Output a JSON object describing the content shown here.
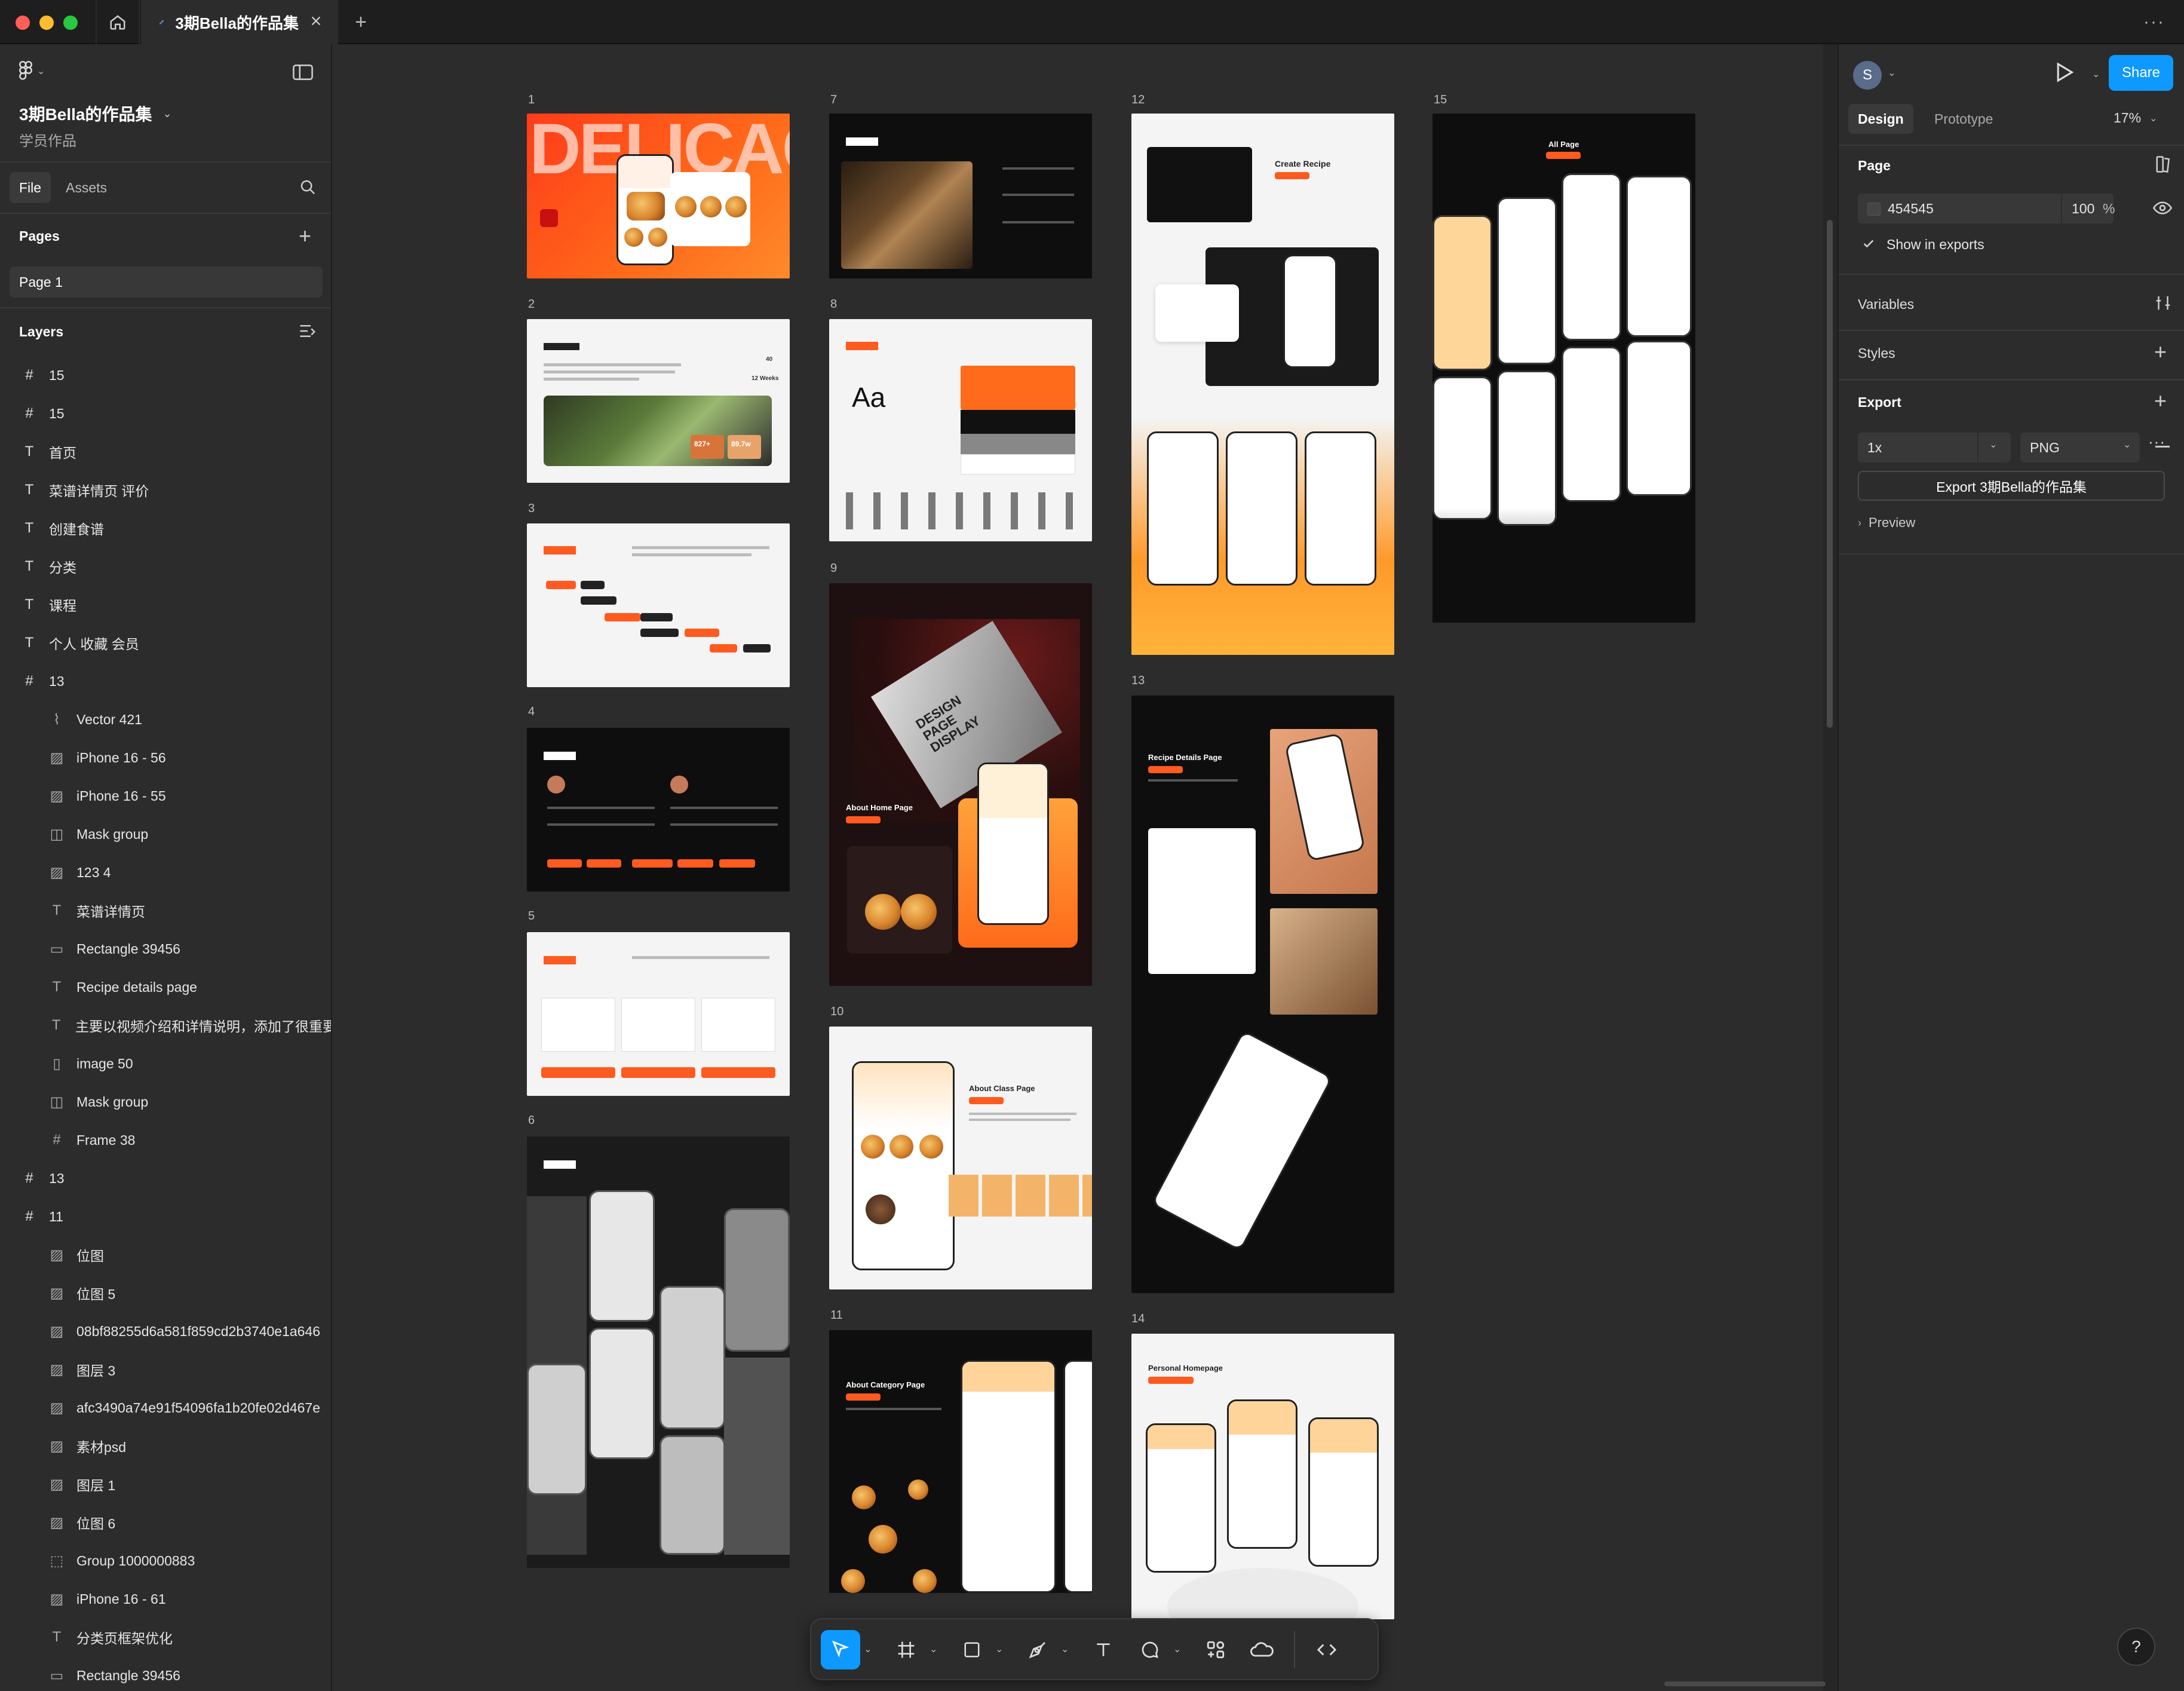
{
  "titlebar": {
    "doc_tab_label": "3期Bella的作品集",
    "new_tab": "+",
    "more": "···"
  },
  "file": {
    "name": "3期Bella的作品集",
    "subtitle": "学员作品",
    "tabs": [
      "File",
      "Assets"
    ]
  },
  "pages": {
    "title": "Pages",
    "items": [
      "Page 1"
    ]
  },
  "layers": {
    "title": "Layers",
    "items": [
      {
        "icon": "frame-icon",
        "glyph": "#",
        "label": "15",
        "level": 0
      },
      {
        "icon": "frame-icon",
        "glyph": "#",
        "label": "15",
        "level": 0
      },
      {
        "icon": "text-icon",
        "glyph": "T",
        "label": "首页",
        "level": 0
      },
      {
        "icon": "text-icon",
        "glyph": "T",
        "label": "菜谱详情页 评价",
        "level": 0
      },
      {
        "icon": "text-icon",
        "glyph": "T",
        "label": "创建食谱",
        "level": 0
      },
      {
        "icon": "text-icon",
        "glyph": "T",
        "label": "分类",
        "level": 0
      },
      {
        "icon": "text-icon",
        "glyph": "T",
        "label": "课程",
        "level": 0
      },
      {
        "icon": "text-icon",
        "glyph": "T",
        "label": "个人 收藏 会员",
        "level": 0
      },
      {
        "icon": "frame-icon",
        "glyph": "#",
        "label": "13",
        "level": 0
      },
      {
        "icon": "vector-icon",
        "glyph": "⌇",
        "label": "Vector 421",
        "level": 1
      },
      {
        "icon": "image-icon",
        "glyph": "▨",
        "label": "iPhone 16 - 56",
        "level": 1
      },
      {
        "icon": "image-icon",
        "glyph": "▨",
        "label": "iPhone 16 - 55",
        "level": 1
      },
      {
        "icon": "mask-icon",
        "glyph": "◫",
        "label": "Mask group",
        "level": 1
      },
      {
        "icon": "image-icon",
        "glyph": "▨",
        "label": "123 4",
        "level": 1
      },
      {
        "icon": "text-icon",
        "glyph": "T",
        "label": "菜谱详情页",
        "level": 1
      },
      {
        "icon": "rectangle-icon",
        "glyph": "▭",
        "label": "Rectangle 39456",
        "level": 1
      },
      {
        "icon": "text-icon",
        "glyph": "T",
        "label": "Recipe details page",
        "level": 1
      },
      {
        "icon": "text-icon",
        "glyph": "T",
        "label": "主要以视频介绍和详情说明，添加了很重要的",
        "level": 1
      },
      {
        "icon": "image-icon",
        "glyph": "▯",
        "label": "image 50",
        "level": 1
      },
      {
        "icon": "mask-icon",
        "glyph": "◫",
        "label": "Mask group",
        "level": 1
      },
      {
        "icon": "frame-icon",
        "glyph": "#",
        "label": "Frame 38",
        "level": 1
      },
      {
        "icon": "frame-icon",
        "glyph": "#",
        "label": "13",
        "level": 0
      },
      {
        "icon": "frame-icon",
        "glyph": "#",
        "label": "11",
        "level": 0
      },
      {
        "icon": "image-icon",
        "glyph": "▨",
        "label": "位图",
        "level": 1
      },
      {
        "icon": "image-icon",
        "glyph": "▨",
        "label": "位图 5",
        "level": 1
      },
      {
        "icon": "image-icon",
        "glyph": "▨",
        "label": "08bf88255d6a581f859cd2b3740e1a646",
        "level": 1
      },
      {
        "icon": "image-icon",
        "glyph": "▨",
        "label": "图层 3",
        "level": 1
      },
      {
        "icon": "image-icon",
        "glyph": "▨",
        "label": "afc3490a74e91f54096fa1b20fe02d467e",
        "level": 1
      },
      {
        "icon": "image-icon",
        "glyph": "▨",
        "label": "素材psd",
        "level": 1
      },
      {
        "icon": "image-icon",
        "glyph": "▨",
        "label": "图层 1",
        "level": 1
      },
      {
        "icon": "image-icon",
        "glyph": "▨",
        "label": "位图 6",
        "level": 1
      },
      {
        "icon": "group-icon",
        "glyph": "⬚",
        "label": "Group 1000000883",
        "level": 1
      },
      {
        "icon": "image-icon",
        "glyph": "▨",
        "label": "iPhone 16 - 61",
        "level": 1
      },
      {
        "icon": "text-icon",
        "glyph": "T",
        "label": "分类页框架优化",
        "level": 1
      },
      {
        "icon": "rectangle-icon",
        "glyph": "▭",
        "label": "Rectangle 39456",
        "level": 1
      }
    ]
  },
  "canvas": {
    "frame_labels": [
      "1",
      "2",
      "3",
      "4",
      "5",
      "6",
      "7",
      "8",
      "9",
      "10",
      "11",
      "12",
      "13",
      "14",
      "15"
    ],
    "frame_texts": {
      "delicacy": "DELICACY",
      "aa": "Aa",
      "create_recipe": "Create Recipe",
      "all_page": "All Page",
      "recipe_details": "Recipe Details Page",
      "about_home": "About Home Page",
      "about_class": "About Class Page",
      "about_category": "About Category Page",
      "personal_homepage": "Personal Homepage",
      "design_display": "DESIGN PAGE DISPLAY",
      "weeks": "12 Weeks",
      "num40": "40",
      "stat1": "827+",
      "stat2": "89.7w"
    }
  },
  "right": {
    "avatar_initial": "S",
    "share_label": "Share",
    "tabs": [
      "Design",
      "Prototype"
    ],
    "zoom": "17%",
    "page_section": "Page",
    "page_color_hex": "454545",
    "page_opacity": "100",
    "page_opacity_unit": "%",
    "show_in_exports": "Show in exports",
    "variables": "Variables",
    "styles": "Styles",
    "export": "Export",
    "export_scale": "1x",
    "export_format": "PNG",
    "export_button": "Export 3期Bella的作品集",
    "preview": "Preview"
  },
  "help": "?",
  "colors": {
    "accent_blue": "#0d99ff",
    "brand_orange": "#ff5a1f",
    "canvas_bg": "#2c2c2c",
    "panel_bg": "#2c2c2c",
    "titlebar_bg": "#1e1e1e",
    "page_swatch": "#454545"
  }
}
